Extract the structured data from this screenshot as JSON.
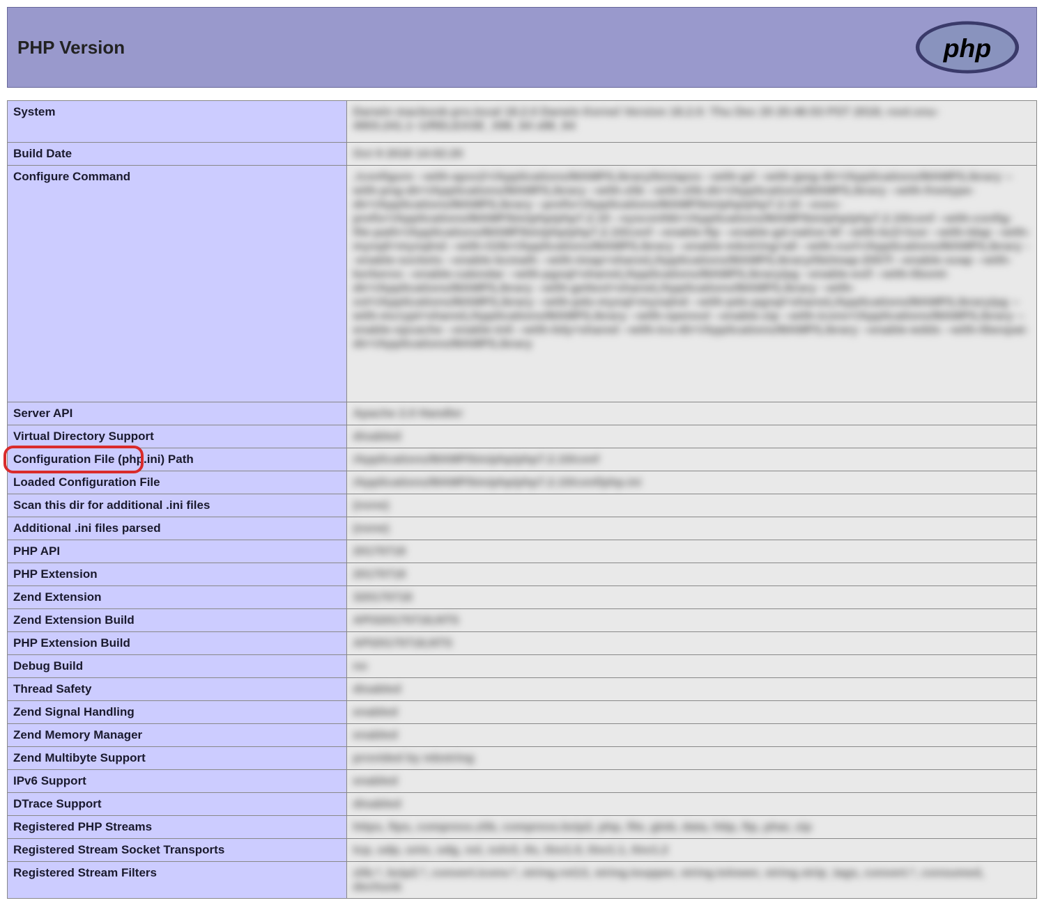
{
  "header": {
    "title": "PHP Version",
    "logo_text": "php"
  },
  "rows": [
    {
      "label": "System",
      "value": "Darwin macbook-pro.local 18.2.0 Darwin Kernel Version 18.2.0: Thu Dec 20 20:46:53 PST 2018; root:xnu-4903.241.1~1/RELEASE_X86_64 x86_64",
      "blurred": true,
      "class": "system-row"
    },
    {
      "label": "Build Date",
      "value": "Oct 9 2018 14:02:20",
      "blurred": true
    },
    {
      "label": "Configure Command",
      "value": "./configure --with-apxs2=/Applications/MAMP/Library/bin/apxs --with-gd --with-jpeg-dir=/Applications/MAMP/Library --with-png-dir=/Applications/MAMP/Library --with-zlib --with-zlib-dir=/Applications/MAMP/Library --with-freetype-dir=/Applications/MAMP/Library --prefix=/Applications/MAMP/bin/php/php7.2.10 --exec-prefix=/Applications/MAMP/bin/php/php7.2.10 --sysconfdir=/Applications/MAMP/bin/php/php7.2.10/conf --with-config-file-path=/Applications/MAMP/bin/php/php7.2.10/conf --enable-ftp --enable-gd-native-ttf --with-bz2=/usr --with-ldap --with-mysqli=mysqlnd --with-t1lib=/Applications/MAMP/Library --enable-mbstring=all --with-curl=/Applications/MAMP/Library --enable-sockets --enable-bcmath --with-imap=shared,/Applications/MAMP/Library/lib/imap-2007f --enable-soap --with-kerberos --enable-calendar --with-pgsql=shared,/Applications/MAMP/Library/pg --enable-exif --with-libxml-dir=/Applications/MAMP/Library --with-gettext=shared,/Applications/MAMP/Library --with-xsl=/Applications/MAMP/Library --with-pdo-mysql=mysqlnd --with-pdo-pgsql=shared,/Applications/MAMP/Library/pg --with-mcrypt=shared,/Applications/MAMP/Library --with-openssl --enable-zip --with-iconv=/Applications/MAMP/Library --enable-opcache --enable-intl --with-tidy=shared --with-icu-dir=/Applications/MAMP/Library --enable-wddx --with-libexpat-dir=/Applications/MAMP/Library",
      "blurred": true,
      "class": "tall-row"
    },
    {
      "label": "Server API",
      "value": "Apache 2.0 Handler",
      "blurred": true
    },
    {
      "label": "Virtual Directory Support",
      "value": "disabled",
      "blurred": true
    },
    {
      "label": "Configuration File (php.ini) Path",
      "value": "/Applications/MAMP/bin/php/php7.2.10/conf",
      "blurred": true,
      "highlight": true
    },
    {
      "label": "Loaded Configuration File",
      "value": "/Applications/MAMP/bin/php/php7.2.10/conf/php.ini",
      "blurred": true
    },
    {
      "label": "Scan this dir for additional .ini files",
      "value": "(none)",
      "blurred": true
    },
    {
      "label": "Additional .ini files parsed",
      "value": "(none)",
      "blurred": true
    },
    {
      "label": "PHP API",
      "value": "20170718",
      "blurred": true
    },
    {
      "label": "PHP Extension",
      "value": "20170718",
      "blurred": true
    },
    {
      "label": "Zend Extension",
      "value": "320170718",
      "blurred": true
    },
    {
      "label": "Zend Extension Build",
      "value": "API320170718,NTS",
      "blurred": true
    },
    {
      "label": "PHP Extension Build",
      "value": "API20170718,NTS",
      "blurred": true
    },
    {
      "label": "Debug Build",
      "value": "no",
      "blurred": true
    },
    {
      "label": "Thread Safety",
      "value": "disabled",
      "blurred": true
    },
    {
      "label": "Zend Signal Handling",
      "value": "enabled",
      "blurred": true
    },
    {
      "label": "Zend Memory Manager",
      "value": "enabled",
      "blurred": true
    },
    {
      "label": "Zend Multibyte Support",
      "value": "provided by mbstring",
      "blurred": true
    },
    {
      "label": "IPv6 Support",
      "value": "enabled",
      "blurred": true
    },
    {
      "label": "DTrace Support",
      "value": "disabled",
      "blurred": true
    },
    {
      "label": "Registered PHP Streams",
      "value": "https, ftps, compress.zlib, compress.bzip2, php, file, glob, data, http, ftp, phar, zip",
      "blurred": true
    },
    {
      "label": "Registered Stream Socket Transports",
      "value": "tcp, udp, unix, udg, ssl, sslv3, tls, tlsv1.0, tlsv1.1, tlsv1.2",
      "blurred": true
    },
    {
      "label": "Registered Stream Filters",
      "value": "zlib.*, bzip2.*, convert.iconv.*, string.rot13, string.toupper, string.tolower, string.strip_tags, convert.*, consumed, dechunk",
      "blurred": true,
      "class": "filter-row"
    }
  ]
}
